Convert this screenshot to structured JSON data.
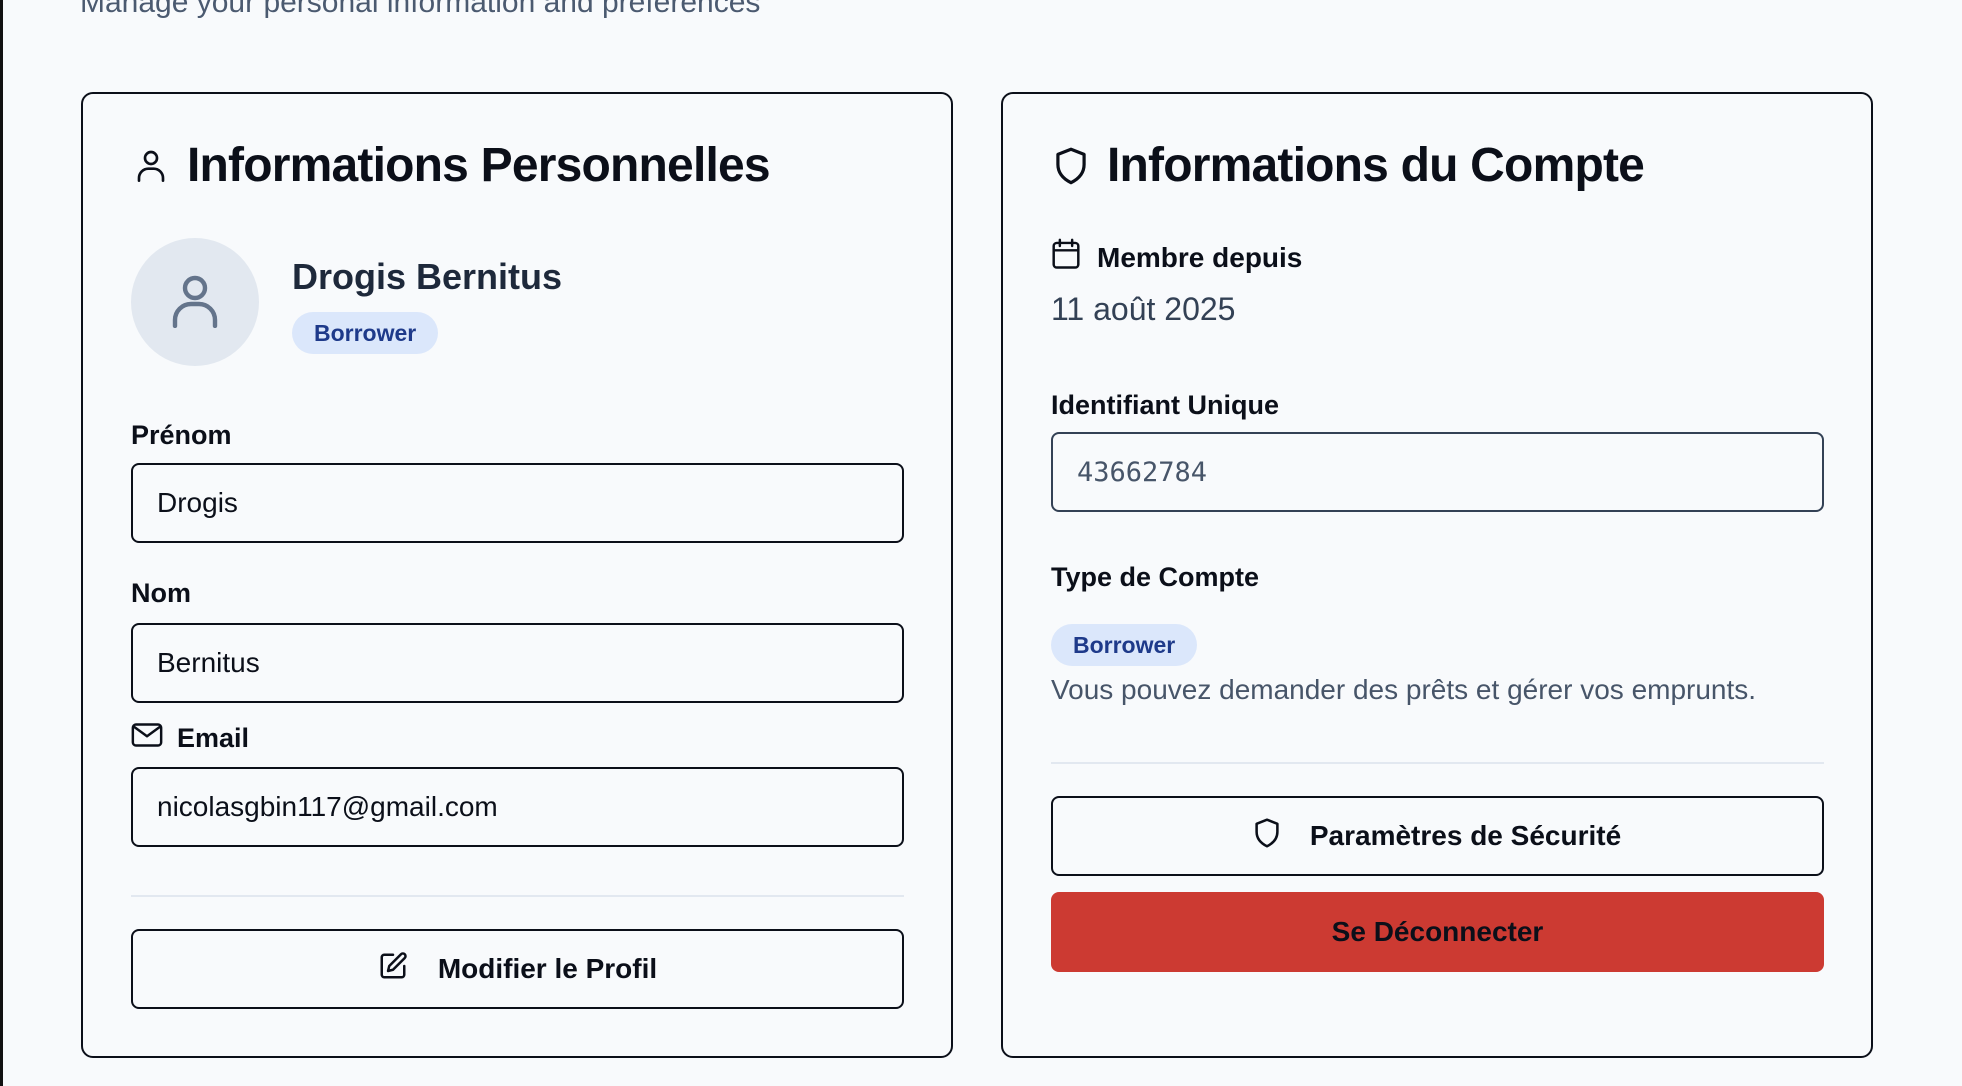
{
  "page": {
    "subtitle": "Manage your personal information and preferences"
  },
  "personal": {
    "title": "Informations Personnelles",
    "icon": "user-icon",
    "profile": {
      "name": "Drogis Bernitus",
      "role_badge": "Borrower",
      "avatar_icon": "user-icon"
    },
    "first_name": {
      "label": "Prénom",
      "value": "Drogis"
    },
    "last_name": {
      "label": "Nom",
      "value": "Bernitus"
    },
    "email": {
      "label": "Email",
      "icon": "mail-icon",
      "value": "nicolasgbin117@gmail.com"
    },
    "edit_button": {
      "label": "Modifier le Profil",
      "icon": "edit-icon"
    }
  },
  "account": {
    "title": "Informations du Compte",
    "icon": "shield-icon",
    "member_since": {
      "label": "Membre depuis",
      "icon": "calendar-icon",
      "value": "11 août 2025"
    },
    "unique_id": {
      "label": "Identifiant Unique",
      "value": "43662784"
    },
    "account_type": {
      "label": "Type de Compte",
      "badge": "Borrower",
      "description": "Vous pouvez demander des prêts et gérer vos emprunts."
    },
    "security_button": {
      "label": "Paramètres de Sécurité",
      "icon": "shield-icon"
    },
    "logout_button": {
      "label": "Se Déconnecter"
    }
  },
  "colors": {
    "background": "#f8fafc",
    "badge_bg": "#dbe7fb",
    "badge_text": "#1e3a8a",
    "danger": "#cc3a32",
    "muted_text": "#475569"
  }
}
